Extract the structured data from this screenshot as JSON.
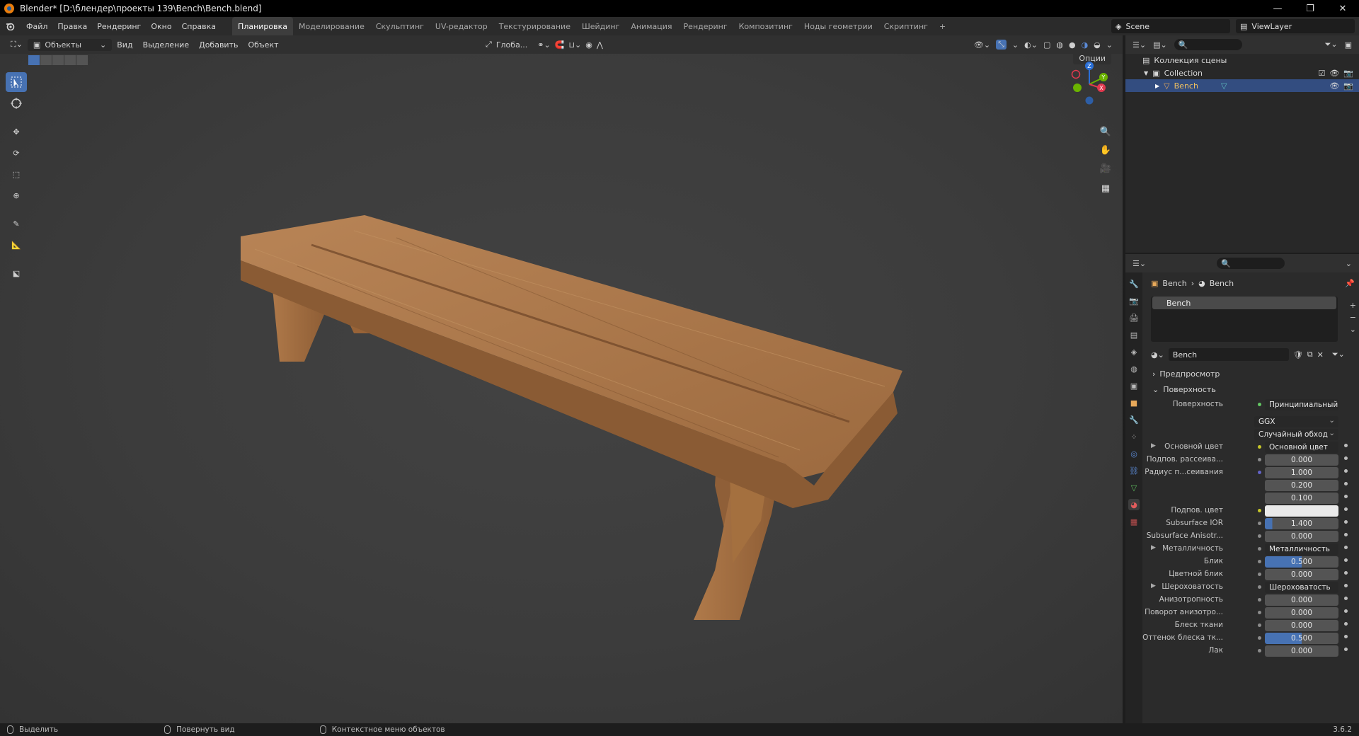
{
  "window": {
    "title": "Blender* [D:\\блендер\\проекты 139\\Bench\\Bench.blend]",
    "controls": [
      "—",
      "❐",
      "✕"
    ]
  },
  "menubar": {
    "items": [
      "Файл",
      "Правка",
      "Рендеринг",
      "Окно",
      "Справка"
    ],
    "workspaces": [
      "Планировка",
      "Моделирование",
      "Скульптинг",
      "UV-редактор",
      "Текстурирование",
      "Шейдинг",
      "Анимация",
      "Рендеринг",
      "Композитинг",
      "Ноды геометрии",
      "Скриптинг"
    ],
    "add_workspace": "+",
    "scene": "Scene",
    "view_layer": "ViewLayer"
  },
  "viewport_header": {
    "mode": "Объекты",
    "menus": [
      "Вид",
      "Выделение",
      "Добавить",
      "Объект"
    ],
    "orientation": "Глоба...",
    "options": "Опции"
  },
  "outliner": {
    "root": "Коллекция сцены",
    "collection": "Collection",
    "object": "Bench"
  },
  "properties": {
    "breadcrumb": [
      "Bench",
      "Bench"
    ],
    "material_slot": "Bench",
    "material_name": "Bench",
    "panels": {
      "preview": "Предпросмотр",
      "surface": "Поверхность"
    },
    "surface_label": "Поверхность",
    "surface_shader": "Принципиальный BSDF",
    "distribution": "GGX",
    "subsurface_method": "Случайный обход",
    "rows": [
      {
        "label": "Основной цвет",
        "value": "Основной цвет",
        "kind": "link",
        "dot": "y",
        "expand": true
      },
      {
        "label": "Подпов. рассеива...",
        "value": "0.000",
        "kind": "num",
        "dot": "gray"
      },
      {
        "label": "Радиус п...сеивания",
        "value": "1.000",
        "kind": "num",
        "dot": "b"
      },
      {
        "label": "",
        "value": "0.200",
        "kind": "num",
        "dot": "none"
      },
      {
        "label": "",
        "value": "0.100",
        "kind": "num",
        "dot": "none"
      },
      {
        "label": "Подпов. цвет",
        "value": "",
        "kind": "color",
        "dot": "y"
      },
      {
        "label": "Subsurface IOR",
        "value": "1.400",
        "kind": "num",
        "dot": "gray",
        "fill": 0.1
      },
      {
        "label": "Subsurface Anisotr...",
        "value": "0.000",
        "kind": "num",
        "dot": "gray"
      },
      {
        "label": "Металличность",
        "value": "Металличность",
        "kind": "link",
        "dot": "gray",
        "expand": true
      },
      {
        "label": "Блик",
        "value": "0.500",
        "kind": "num",
        "dot": "gray",
        "fill": 0.5
      },
      {
        "label": "Цветной блик",
        "value": "0.000",
        "kind": "num",
        "dot": "gray"
      },
      {
        "label": "Шероховатость",
        "value": "Шероховатость",
        "kind": "link",
        "dot": "gray",
        "expand": true
      },
      {
        "label": "Анизотропность",
        "value": "0.000",
        "kind": "num",
        "dot": "gray"
      },
      {
        "label": "Поворот анизотро...",
        "value": "0.000",
        "kind": "num",
        "dot": "gray"
      },
      {
        "label": "Блеск ткани",
        "value": "0.000",
        "kind": "num",
        "dot": "gray"
      },
      {
        "label": "Оттенок блеска тк...",
        "value": "0.500",
        "kind": "num",
        "dot": "gray",
        "fill": 0.5
      },
      {
        "label": "Лак",
        "value": "0.000",
        "kind": "num",
        "dot": "gray"
      }
    ]
  },
  "statusbar": {
    "select": "Выделить",
    "rotate": "Повернуть вид",
    "context": "Контекстное меню объектов",
    "version": "3.6.2"
  },
  "colors": {
    "accent": "#4772b3",
    "selection": "#334d80",
    "wood": "#a87448"
  }
}
